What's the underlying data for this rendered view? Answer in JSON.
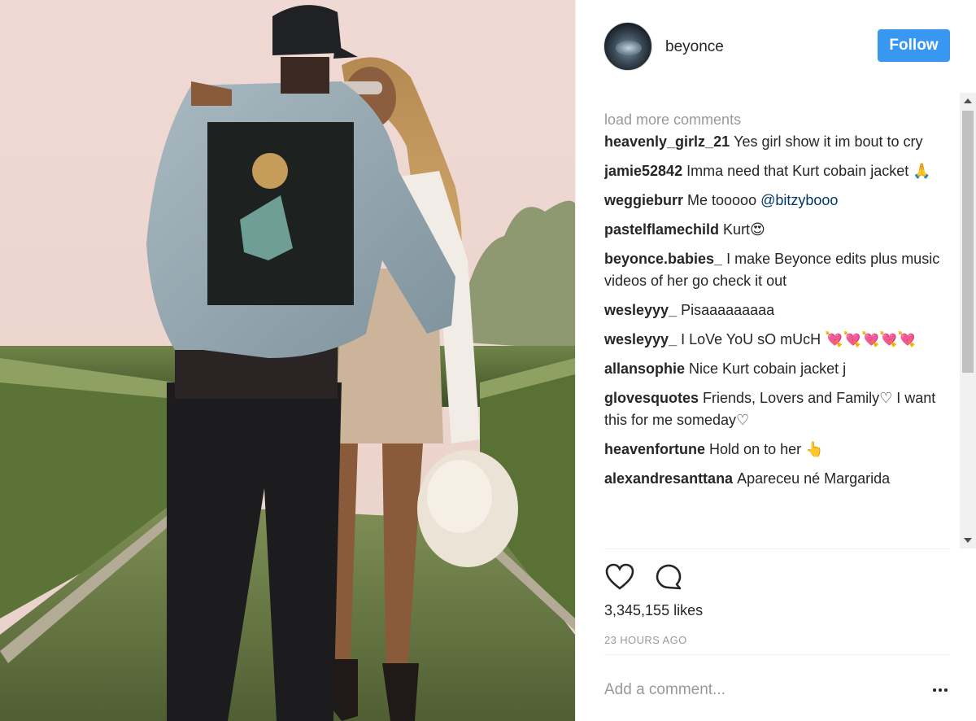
{
  "header": {
    "username": "beyonce",
    "follow_label": "Follow"
  },
  "comments_section": {
    "load_more_label": "load more comments",
    "items": [
      {
        "user": "heavenly_girlz_21",
        "text": "Yes girl show it im bout to cry"
      },
      {
        "user": "jamie52842",
        "text": "Imma need that Kurt cobain jacket 🙏"
      },
      {
        "user": "weggieburr",
        "text": "Me tooooo",
        "mention": "@bitzybooo"
      },
      {
        "user": "pastelflamechild",
        "text": "Kurt😍"
      },
      {
        "user": "beyonce.babies_",
        "text": "I make Beyonce edits plus music videos of her go check it out"
      },
      {
        "user": "wesleyyy_",
        "text": "Pisaaaaaaaaa"
      },
      {
        "user": "wesleyyy_",
        "text": "I LoVe YoU sO mUcH 💘💘💘💘💘"
      },
      {
        "user": "allansophie",
        "text": "Nice Kurt cobain jacket j"
      },
      {
        "user": "glovesquotes",
        "text": "Friends, Lovers and Family♡ I want this for me someday♡"
      },
      {
        "user": "heavenfortune",
        "text": "Hold on to her 👆"
      },
      {
        "user": "alexandresanttana",
        "text": "Apareceu né Margarida"
      }
    ]
  },
  "actions": {
    "like_icon": "heart-icon",
    "comment_icon": "comment-bubble-icon"
  },
  "stats": {
    "likes_text": "3,345,155 likes",
    "timestamp": "23 HOURS AGO"
  },
  "comment_box": {
    "placeholder": "Add a comment...",
    "more_icon": "more-options-icon"
  },
  "colors": {
    "follow_blue": "#3897f0",
    "mention_blue": "#003569",
    "muted_gray": "#999999"
  }
}
